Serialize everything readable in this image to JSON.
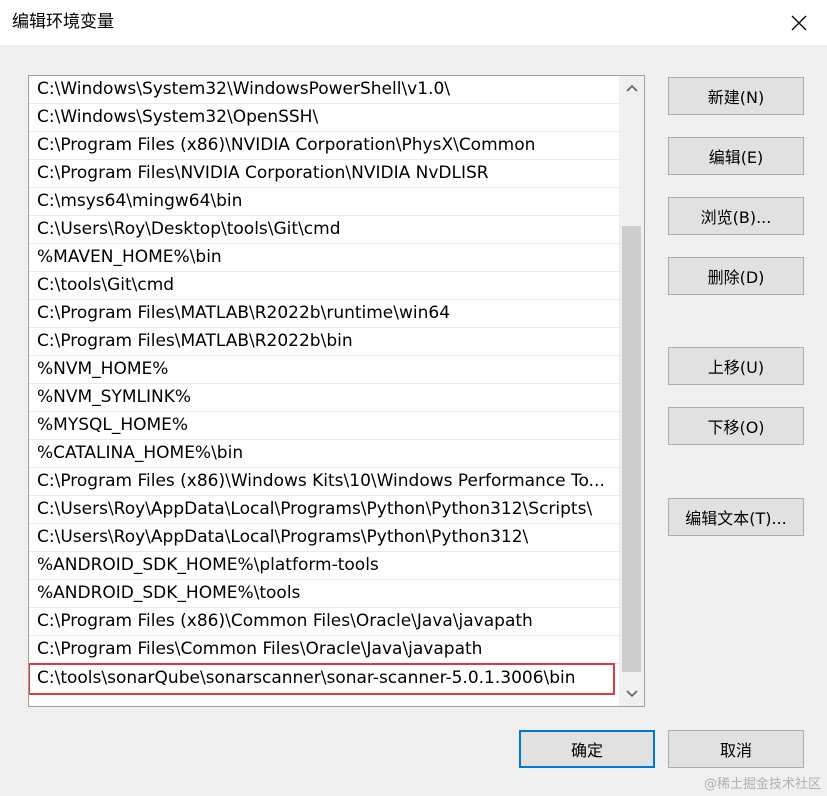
{
  "window": {
    "title": "编辑环境变量",
    "close_icon": "close-icon"
  },
  "path_list": {
    "items": [
      "C:\\Windows\\System32\\WindowsPowerShell\\v1.0\\",
      "C:\\Windows\\System32\\OpenSSH\\",
      "C:\\Program Files (x86)\\NVIDIA Corporation\\PhysX\\Common",
      "C:\\Program Files\\NVIDIA Corporation\\NVIDIA NvDLISR",
      "C:\\msys64\\mingw64\\bin",
      "C:\\Users\\Roy\\Desktop\\tools\\Git\\cmd",
      "%MAVEN_HOME%\\bin",
      "C:\\tools\\Git\\cmd",
      "C:\\Program Files\\MATLAB\\R2022b\\runtime\\win64",
      "C:\\Program Files\\MATLAB\\R2022b\\bin",
      "%NVM_HOME%",
      "%NVM_SYMLINK%",
      "%MYSQL_HOME%",
      "%CATALINA_HOME%\\bin",
      "C:\\Program Files (x86)\\Windows Kits\\10\\Windows Performance To...",
      "C:\\Users\\Roy\\AppData\\Local\\Programs\\Python\\Python312\\Scripts\\",
      "C:\\Users\\Roy\\AppData\\Local\\Programs\\Python\\Python312\\",
      "%ANDROID_SDK_HOME%\\platform-tools",
      "%ANDROID_SDK_HOME%\\tools",
      "C:\\Program Files (x86)\\Common Files\\Oracle\\Java\\javapath",
      "C:\\Program Files\\Common Files\\Oracle\\Java\\javapath"
    ],
    "editing_item": "C:\\tools\\sonarQube\\sonarscanner\\sonar-scanner-5.0.1.3006\\bin",
    "highlight_color": "#e0393e"
  },
  "buttons": {
    "new": "新建(N)",
    "edit": "编辑(E)",
    "browse": "浏览(B)...",
    "delete": "删除(D)",
    "move_up": "上移(U)",
    "move_down": "下移(O)",
    "edit_text": "编辑文本(T)...",
    "ok": "确定",
    "cancel": "取消"
  },
  "watermark": "@稀土掘金技术社区"
}
